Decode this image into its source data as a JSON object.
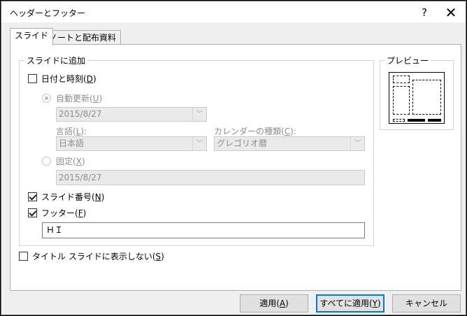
{
  "dialog": {
    "title": "ヘッダーとフッター",
    "help_icon": "?",
    "close_icon": "✕"
  },
  "tabs": [
    {
      "label": "スライド",
      "active": true
    },
    {
      "label": "ノートと配布資料",
      "active": false
    }
  ],
  "slide_group": {
    "legend": "スライドに追加",
    "date_time": {
      "label": "日付と時刻",
      "accel": "D",
      "checked": false
    },
    "auto_update": {
      "label": "自動更新",
      "accel": "U",
      "selected": true
    },
    "auto_date_value": "2015/8/27",
    "language": {
      "label": "言語",
      "accel": "L",
      "value": "日本語"
    },
    "calendar": {
      "label": "カレンダーの種類",
      "accel": "C",
      "value": "グレゴリオ暦"
    },
    "fixed": {
      "label": "固定",
      "accel": "X",
      "selected": false
    },
    "fixed_value": "2015/8/27",
    "slide_number": {
      "label": "スライド番号",
      "accel": "N",
      "checked": true
    },
    "footer": {
      "label": "フッター",
      "accel": "F",
      "checked": true
    },
    "footer_value": "ＨＩ"
  },
  "hide_title": {
    "label": "タイトル スライドに表示しない",
    "accel": "S",
    "checked": false
  },
  "preview": {
    "legend": "プレビュー"
  },
  "buttons": {
    "apply": {
      "label": "適用",
      "accel": "A"
    },
    "apply_all": {
      "label": "すべてに適用",
      "accel": "Y"
    },
    "cancel": {
      "label": "キャンセル"
    }
  },
  "colors": {
    "dialog_bg": "#f0f0f0",
    "accent": "#0078d7",
    "disabled_text": "#8d8d8d"
  }
}
